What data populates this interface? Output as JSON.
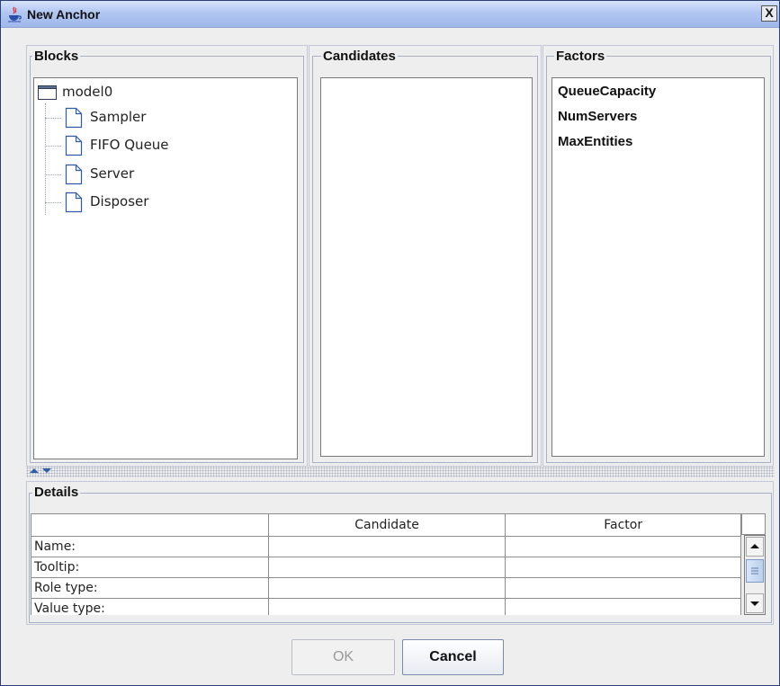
{
  "window": {
    "title": "New Anchor",
    "close_glyph": "X"
  },
  "blocks": {
    "title": "Blocks",
    "tree": {
      "root": "model0",
      "children": [
        "Sampler",
        "FIFO Queue",
        "Server",
        "Disposer"
      ]
    }
  },
  "candidates": {
    "title": "Candidates",
    "items": []
  },
  "factors": {
    "title": "Factors",
    "items": [
      "QueueCapacity",
      "NumServers",
      "MaxEntities"
    ]
  },
  "details": {
    "title": "Details",
    "columns": [
      "",
      "Candidate",
      "Factor"
    ],
    "rows": [
      {
        "label": "Name:",
        "candidate": "",
        "factor": ""
      },
      {
        "label": "Tooltip:",
        "candidate": "",
        "factor": ""
      },
      {
        "label": "Role type:",
        "candidate": "",
        "factor": ""
      },
      {
        "label": "Value type:",
        "candidate": "",
        "factor": ""
      }
    ]
  },
  "buttons": {
    "ok": "OK",
    "cancel": "Cancel"
  },
  "icons": {
    "window": "java-cup-icon",
    "root": "folder-icon",
    "leaf": "document-icon"
  }
}
